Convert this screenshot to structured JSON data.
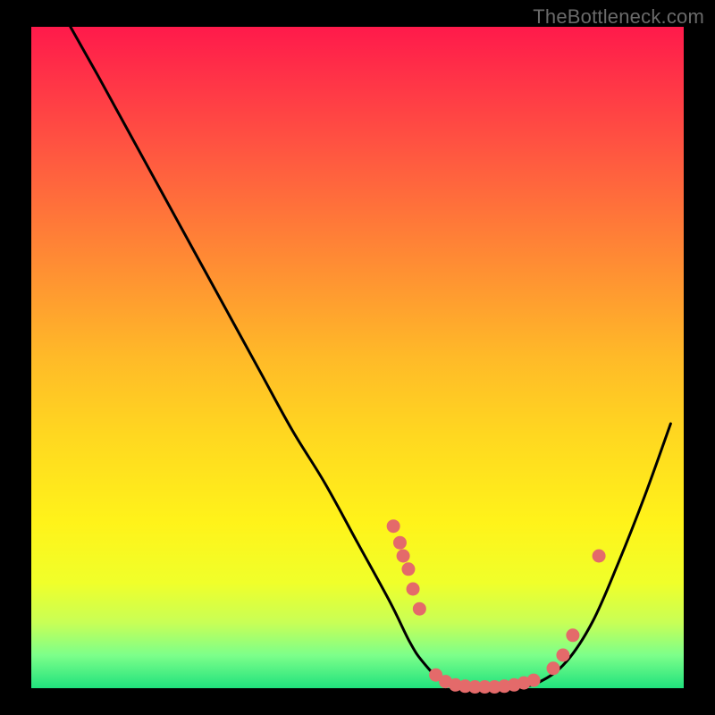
{
  "watermark": "TheBottleneck.com",
  "colors": {
    "page_bg": "#000000",
    "curve": "#000000",
    "points": "#e46a6a",
    "gradient_top": "#ff1a4b",
    "gradient_bottom": "#20e27d"
  },
  "chart_data": {
    "type": "line",
    "title": "",
    "xlabel": "",
    "ylabel": "",
    "xlim": [
      0,
      100
    ],
    "ylim": [
      0,
      100
    ],
    "series": [
      {
        "name": "bottleneck-curve",
        "x": [
          6,
          10,
          15,
          20,
          25,
          30,
          35,
          40,
          45,
          50,
          55,
          58,
          60,
          63,
          66,
          70,
          74,
          78,
          82,
          86,
          90,
          94,
          98
        ],
        "y": [
          100,
          93,
          84,
          75,
          66,
          57,
          48,
          39,
          31,
          22,
          13,
          7,
          4,
          1,
          0,
          0,
          0,
          1,
          4,
          10,
          19,
          29,
          40
        ]
      }
    ],
    "points": [
      {
        "x": 55.5,
        "y": 24.5
      },
      {
        "x": 56.5,
        "y": 22.0
      },
      {
        "x": 57.0,
        "y": 20.0
      },
      {
        "x": 57.8,
        "y": 18.0
      },
      {
        "x": 58.5,
        "y": 15.0
      },
      {
        "x": 59.5,
        "y": 12.0
      },
      {
        "x": 62.0,
        "y": 2.0
      },
      {
        "x": 63.5,
        "y": 1.0
      },
      {
        "x": 65.0,
        "y": 0.5
      },
      {
        "x": 66.5,
        "y": 0.3
      },
      {
        "x": 68.0,
        "y": 0.2
      },
      {
        "x": 69.5,
        "y": 0.2
      },
      {
        "x": 71.0,
        "y": 0.2
      },
      {
        "x": 72.5,
        "y": 0.3
      },
      {
        "x": 74.0,
        "y": 0.5
      },
      {
        "x": 75.5,
        "y": 0.8
      },
      {
        "x": 77.0,
        "y": 1.2
      },
      {
        "x": 80.0,
        "y": 3.0
      },
      {
        "x": 81.5,
        "y": 5.0
      },
      {
        "x": 83.0,
        "y": 8.0
      },
      {
        "x": 87.0,
        "y": 20.0
      }
    ]
  }
}
